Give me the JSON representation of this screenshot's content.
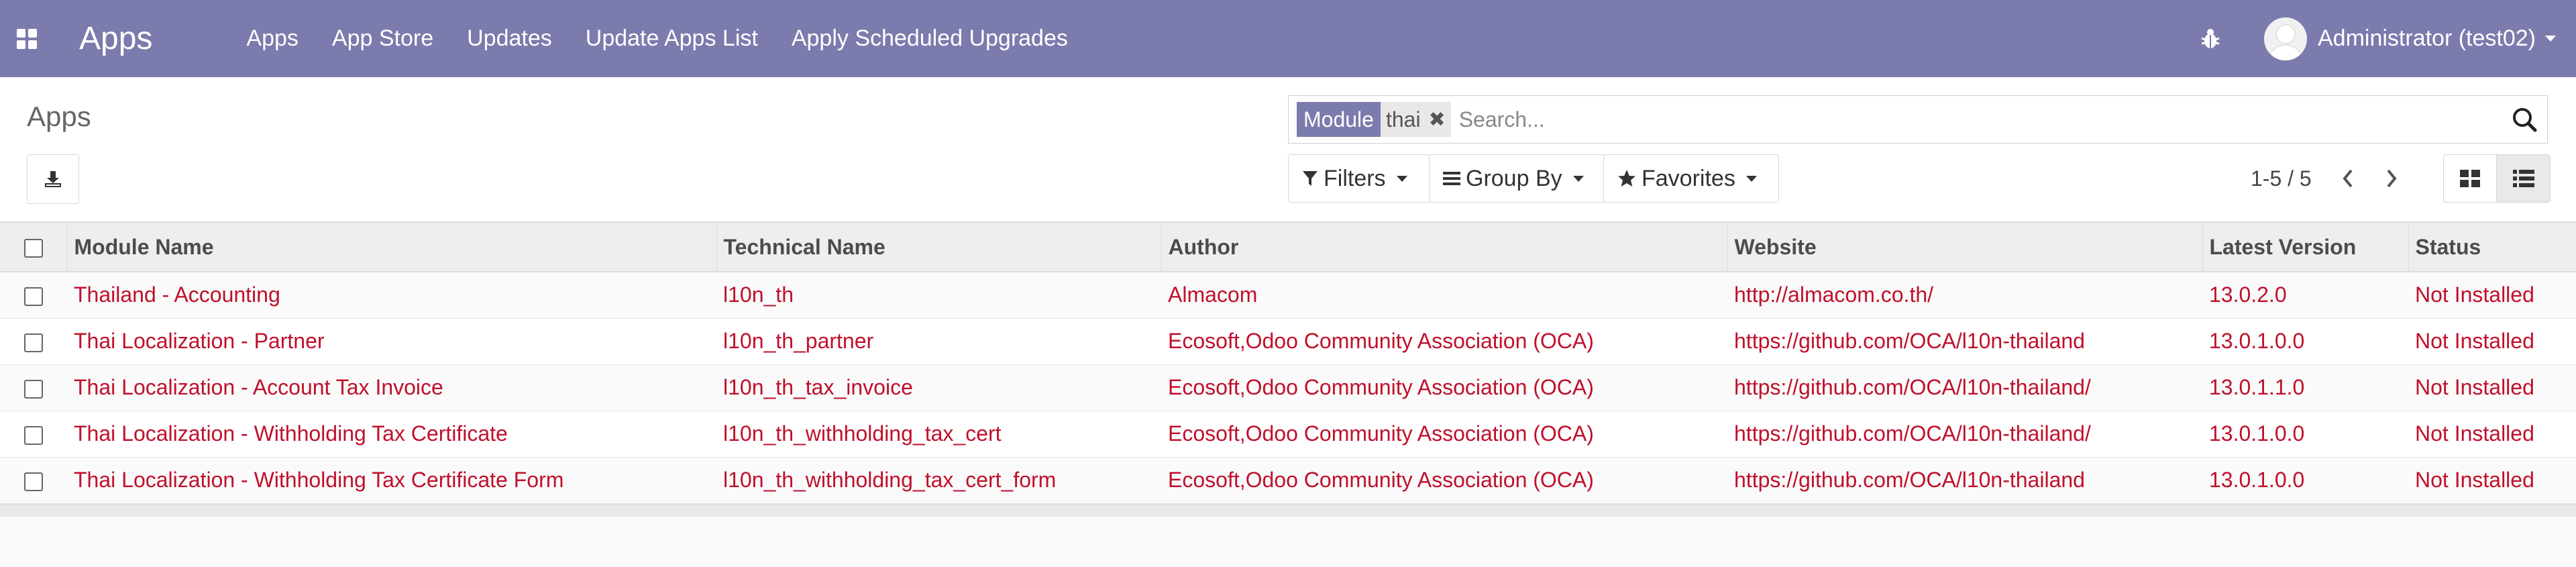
{
  "navbar": {
    "brand": "Apps",
    "menu": [
      "Apps",
      "App Store",
      "Updates",
      "Update Apps List",
      "Apply Scheduled Upgrades"
    ],
    "user": "Administrator (test02)",
    "bg_color": "#7c7bad"
  },
  "control_panel": {
    "title": "Apps",
    "search": {
      "facet_label": "Module",
      "facet_value": "thai",
      "placeholder": "Search..."
    },
    "buttons": {
      "filters": "Filters",
      "group_by": "Group By",
      "favorites": "Favorites"
    },
    "pager": "1-5 / 5"
  },
  "table": {
    "columns": [
      "Module Name",
      "Technical Name",
      "Author",
      "Website",
      "Latest Version",
      "Status"
    ],
    "rows": [
      {
        "name": "Thailand - Accounting",
        "technical": "l10n_th",
        "author": "Almacom",
        "website": "http://almacom.co.th/",
        "version": "13.0.2.0",
        "status": "Not Installed"
      },
      {
        "name": "Thai Localization - Partner",
        "technical": "l10n_th_partner",
        "author": "Ecosoft,Odoo Community Association (OCA)",
        "website": "https://github.com/OCA/l10n-thailand",
        "version": "13.0.1.0.0",
        "status": "Not Installed"
      },
      {
        "name": "Thai Localization - Account Tax Invoice",
        "technical": "l10n_th_tax_invoice",
        "author": "Ecosoft,Odoo Community Association (OCA)",
        "website": "https://github.com/OCA/l10n-thailand/",
        "version": "13.0.1.1.0",
        "status": "Not Installed"
      },
      {
        "name": "Thai Localization - Withholding Tax Certificate",
        "technical": "l10n_th_withholding_tax_cert",
        "author": "Ecosoft,Odoo Community Association (OCA)",
        "website": "https://github.com/OCA/l10n-thailand/",
        "version": "13.0.1.0.0",
        "status": "Not Installed"
      },
      {
        "name": "Thai Localization - Withholding Tax Certificate Form",
        "technical": "l10n_th_withholding_tax_cert_form",
        "author": "Ecosoft,Odoo Community Association (OCA)",
        "website": "https://github.com/OCA/l10n-thailand",
        "version": "13.0.1.0.0",
        "status": "Not Installed"
      }
    ]
  }
}
